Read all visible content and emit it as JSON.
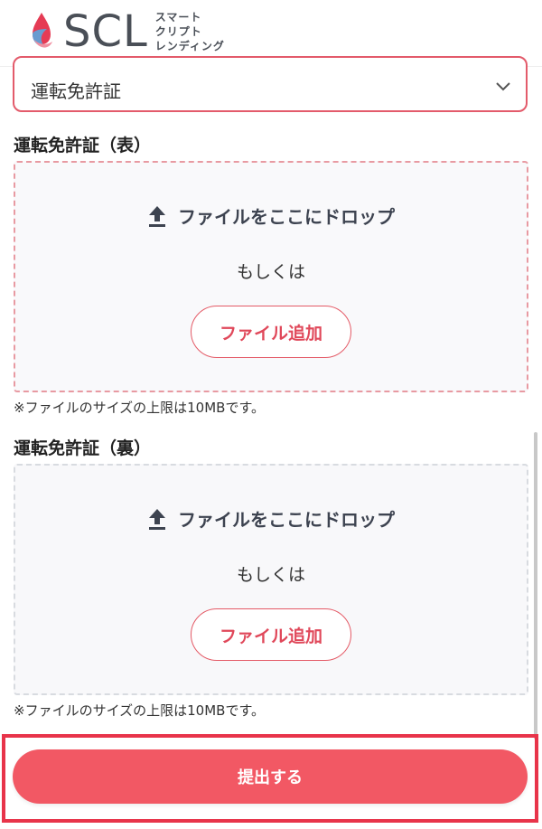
{
  "header": {
    "logo_text": "SCL",
    "logo_sub": [
      "スマート",
      "クリプト",
      "レンディング"
    ]
  },
  "id_type_select": {
    "value": "運転免許証"
  },
  "front": {
    "label": "運転免許証（表）",
    "drop_text": "ファイルをここにドロップ",
    "or_text": "もしくは",
    "add_button": "ファイル追加",
    "note": "※ファイルのサイズの上限は10MBです。"
  },
  "back": {
    "label": "運転免許証（裏）",
    "drop_text": "ファイルをここにドロップ",
    "or_text": "もしくは",
    "add_button": "ファイル追加",
    "note": "※ファイルのサイズの上限は10MBです。"
  },
  "submit": {
    "label": "提出する"
  },
  "colors": {
    "accent": "#e0485a",
    "submit_bg": "#f25864",
    "highlight_frame": "#e8344a"
  },
  "icons": {
    "chevron": "chevron-down-icon",
    "upload": "upload-icon"
  }
}
